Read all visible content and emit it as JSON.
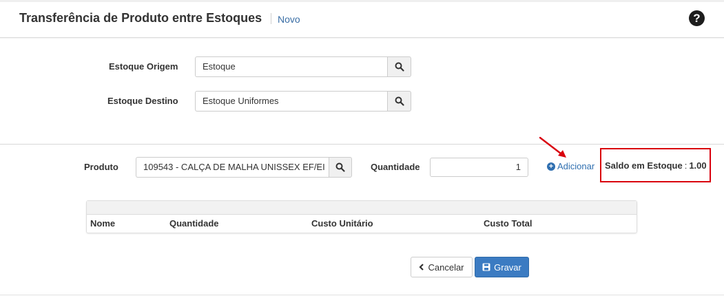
{
  "header": {
    "title": "Transferência de Produto entre Estoques",
    "subtitle": "Novo"
  },
  "form": {
    "origem": {
      "label": "Estoque Origem",
      "value": "Estoque"
    },
    "destino": {
      "label": "Estoque Destino",
      "value": "Estoque Uniformes"
    }
  },
  "item": {
    "produto": {
      "label": "Produto",
      "value": "109543 - CALÇA DE MALHA UNISSEX EF/EI"
    },
    "quantidade": {
      "label": "Quantidade",
      "value": "1"
    },
    "add_label": "Adicionar",
    "saldo_label": "Saldo em Estoque",
    "saldo_value": "1.00"
  },
  "table": {
    "columns": [
      "Nome",
      "Quantidade",
      "Custo Unitário",
      "Custo Total"
    ]
  },
  "actions": {
    "cancel_label": "Cancelar",
    "save_label": "Gravar"
  },
  "colors": {
    "link": "#2f6fb0",
    "primary_button": "#3b7bc2",
    "highlight_box": "#d9000d"
  }
}
